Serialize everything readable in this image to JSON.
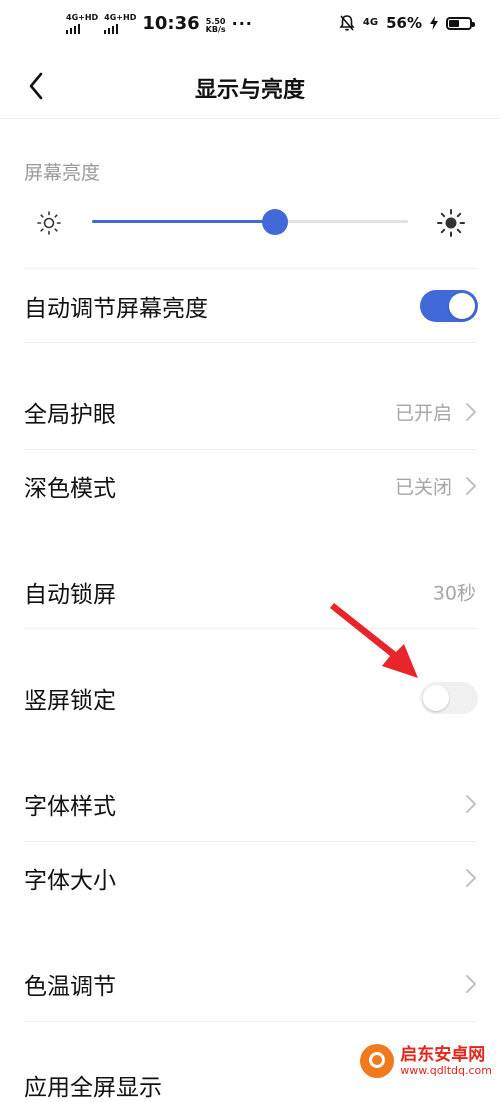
{
  "status_bar": {
    "network_1": "4G+HD",
    "network_2": "4G+HD",
    "time": "10:36",
    "speed_value": "5.50",
    "speed_unit": "KB/s",
    "more": "···",
    "network_3": "4G",
    "battery_percent": "56%",
    "battery_level": 0.56,
    "charging_icon": "bolt-icon",
    "muted_icon": "bell-off-icon"
  },
  "header": {
    "back_icon": "chevron-left-icon",
    "title": "显示与亮度"
  },
  "brightness": {
    "section_label": "屏幕亮度",
    "low_icon": "sun-small-icon",
    "high_icon": "sun-large-icon",
    "level": 0.58
  },
  "settings": {
    "auto_brightness": {
      "label": "自动调节屏幕亮度",
      "on": true
    },
    "eye_protection": {
      "label": "全局护眼",
      "value": "已开启"
    },
    "dark_mode": {
      "label": "深色模式",
      "value": "已关闭"
    },
    "auto_lock": {
      "label": "自动锁屏",
      "value": "30秒"
    },
    "portrait_lock": {
      "label": "竖屏锁定",
      "on": false
    },
    "font_style": {
      "label": "字体样式"
    },
    "font_size": {
      "label": "字体大小"
    },
    "color_temp": {
      "label": "色温调节"
    },
    "app_fullscreen": {
      "label": "应用全屏显示"
    }
  },
  "watermark": {
    "name": "启东安卓网",
    "url": "www.qdltdq.com"
  },
  "colors": {
    "accent": "#4169d8",
    "annotation_arrow": "#e8252a"
  }
}
